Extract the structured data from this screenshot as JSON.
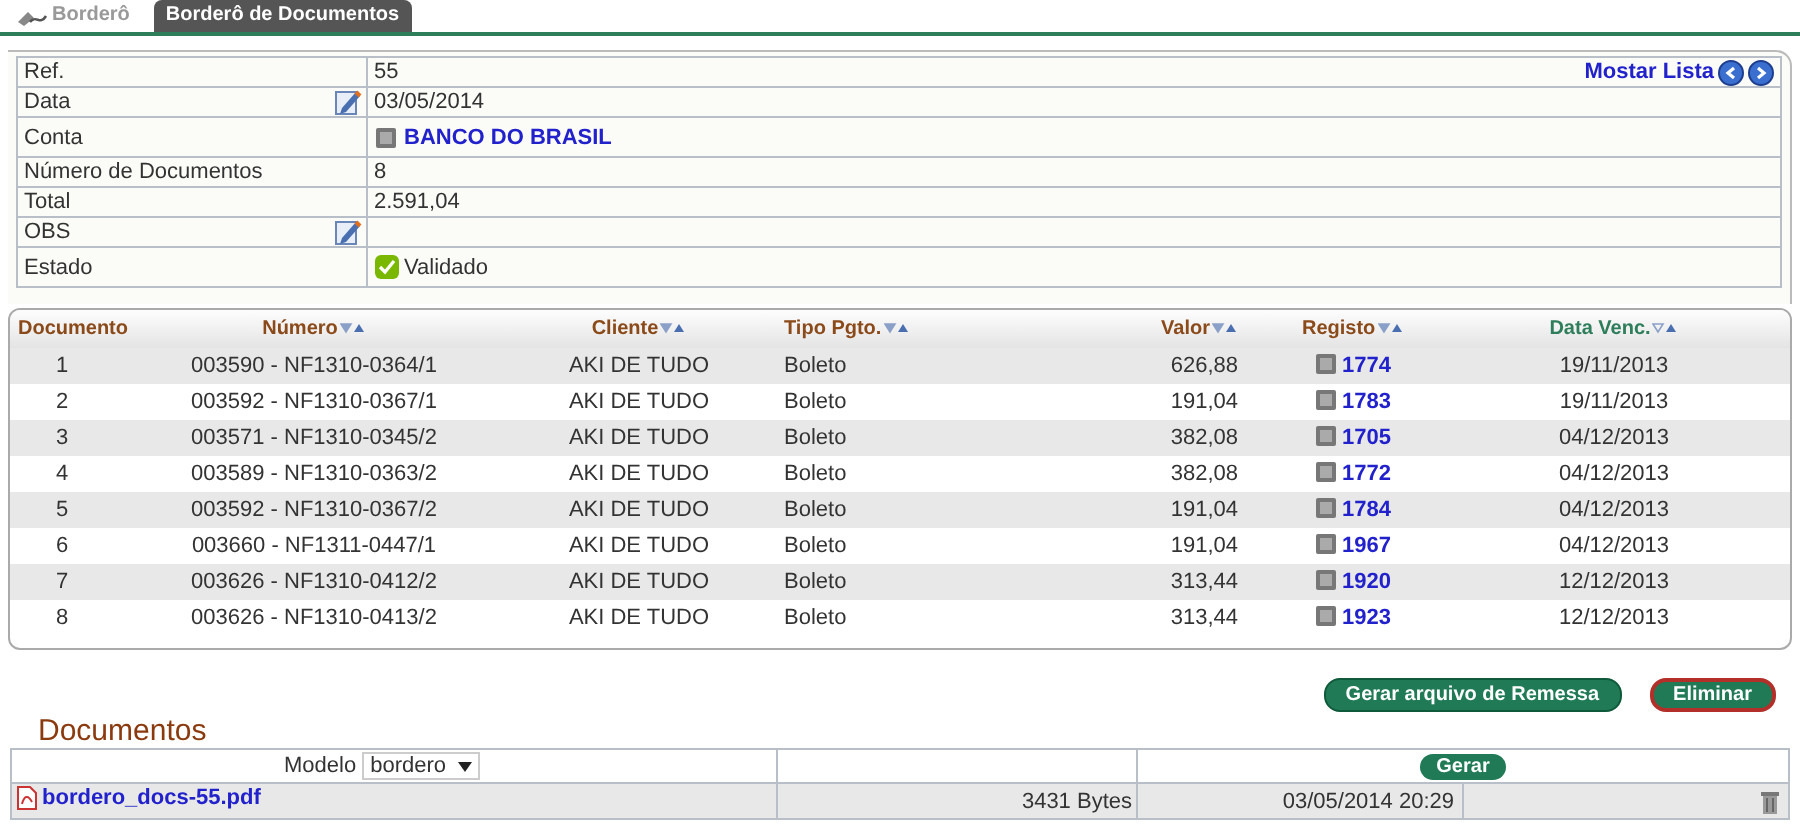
{
  "tabs": [
    {
      "label": "Borderô",
      "selected": false
    },
    {
      "label": "Borderô de Documentos",
      "selected": true
    }
  ],
  "info": {
    "show_list_link": "Mostar Lista",
    "rows": [
      {
        "label": "Ref.",
        "kind": "text",
        "value": "55",
        "editable": false
      },
      {
        "label": "Data",
        "kind": "text",
        "value": "03/05/2014",
        "editable": true
      },
      {
        "label": "Conta",
        "kind": "bank",
        "value": "BANCO DO BRASIL",
        "editable": false
      },
      {
        "label": "Número de Documentos",
        "kind": "text",
        "value": "8",
        "editable": false
      },
      {
        "label": "Total",
        "kind": "text",
        "value": "2.591,04",
        "editable": false
      },
      {
        "label": "OBS",
        "kind": "text",
        "editable": true
      },
      {
        "label": "Estado",
        "kind": "status",
        "value": "Validado",
        "editable": false
      }
    ]
  },
  "table": {
    "columns": [
      {
        "label": "Documento",
        "sortable": false,
        "sorted": false
      },
      {
        "label": "Número",
        "sortable": true,
        "sorted": false
      },
      {
        "label": "Cliente",
        "sortable": true,
        "sorted": false
      },
      {
        "label": "Tipo Pgto.",
        "sortable": true,
        "sorted": false
      },
      {
        "label": "Valor",
        "sortable": true,
        "sorted": false
      },
      {
        "label": "Registo",
        "sortable": true,
        "sorted": false
      },
      {
        "label": "Data Venc.",
        "sortable": true,
        "sorted": true
      }
    ],
    "rows": [
      [
        "1",
        "003590 - NF1310-0364/1",
        "AKI DE TUDO",
        "Boleto",
        "626,88",
        "1774",
        "19/11/2013"
      ],
      [
        "2",
        "003592 - NF1310-0367/1",
        "AKI DE TUDO",
        "Boleto",
        "191,04",
        "1783",
        "19/11/2013"
      ],
      [
        "3",
        "003571 - NF1310-0345/2",
        "AKI DE TUDO",
        "Boleto",
        "382,08",
        "1705",
        "04/12/2013"
      ],
      [
        "4",
        "003589 - NF1310-0363/2",
        "AKI DE TUDO",
        "Boleto",
        "382,08",
        "1772",
        "04/12/2013"
      ],
      [
        "5",
        "003592 - NF1310-0367/2",
        "AKI DE TUDO",
        "Boleto",
        "191,04",
        "1784",
        "04/12/2013"
      ],
      [
        "6",
        "003660 - NF1311-0447/1",
        "AKI DE TUDO",
        "Boleto",
        "191,04",
        "1967",
        "04/12/2013"
      ],
      [
        "7",
        "003626 - NF1310-0412/2",
        "AKI DE TUDO",
        "Boleto",
        "313,44",
        "1920",
        "12/12/2013"
      ],
      [
        "8",
        "003626 - NF1310-0413/2",
        "AKI DE TUDO",
        "Boleto",
        "313,44",
        "1923",
        "12/12/2013"
      ]
    ]
  },
  "actions": [
    {
      "label": "Gerar arquivo de Remessa",
      "kind": "primary"
    },
    {
      "label": "Eliminar",
      "kind": "danger"
    }
  ],
  "documents": {
    "title": "Documentos",
    "model_label": "Modelo",
    "model_value": "bordero",
    "generate_button": "Gerar",
    "files": [
      {
        "name": "bordero_docs-55.pdf",
        "size": "3431 Bytes",
        "date": "03/05/2014 20:29"
      }
    ]
  }
}
